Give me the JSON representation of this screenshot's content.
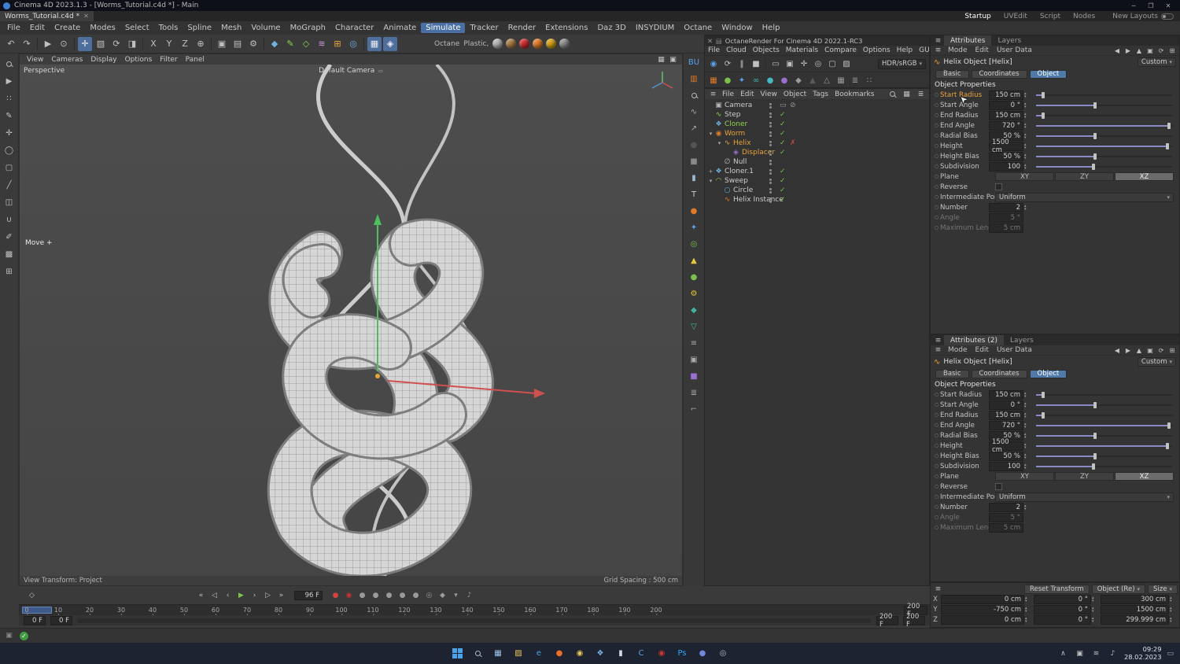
{
  "colors": {
    "accent_blue": "#4e79a8",
    "menu_active_blue": "#4a6fa5",
    "highlight_orange": "#e8a33b",
    "check_green": "#7cc14c",
    "cross_red": "#d04444",
    "slider_fill": "#8a8ac4",
    "taskbar_bg": "#1d2330",
    "viewport_bg": "#484848"
  },
  "titlebar": {
    "title": "Cinema 4D 2023.1.3 - [Worms_Tutorial.c4d *] - Main",
    "controls": [
      {
        "n": "minimize-button",
        "g": "─"
      },
      {
        "n": "maximize-button",
        "g": "❐"
      },
      {
        "n": "close-button",
        "g": "✕"
      }
    ]
  },
  "tabbar": {
    "document_tab": "Worms_Tutorial.c4d *",
    "close_glyph": "✕",
    "layouts": [
      "Startup",
      "UVEdit",
      "Script",
      "Nodes"
    ],
    "active_layout": "Startup",
    "new_layouts_label": "New Layouts"
  },
  "menubar": {
    "items": [
      "File",
      "Edit",
      "Create",
      "Modes",
      "Select",
      "Tools",
      "Spline",
      "Mesh",
      "Volume",
      "MoGraph",
      "Character",
      "Animate",
      "Simulate",
      "Tracker",
      "Render",
      "Extensions",
      "Daz 3D",
      "INSYDIUM",
      "Octane",
      "Window",
      "Help"
    ],
    "active": "Simulate"
  },
  "main_toolbar": {
    "icons": [
      {
        "n": "undo-icon",
        "g": "↶"
      },
      {
        "n": "redo-icon",
        "g": "↷"
      },
      {
        "sep": true
      },
      {
        "n": "selection-tool-icon",
        "g": "▶"
      },
      {
        "n": "live-selection-icon",
        "g": "⊙"
      },
      {
        "sep": true
      },
      {
        "n": "move-tool-icon",
        "g": "✛",
        "hl": true
      },
      {
        "n": "scale-tool-icon",
        "g": "▧"
      },
      {
        "n": "rotate-tool-icon",
        "g": "⟳"
      },
      {
        "n": "last-tool-icon",
        "g": "◨"
      },
      {
        "sep": true
      },
      {
        "n": "x-axis-lock-button",
        "g": "X"
      },
      {
        "n": "y-axis-lock-button",
        "g": "Y"
      },
      {
        "n": "z-axis-lock-button",
        "g": "Z"
      },
      {
        "n": "coordinate-system-button",
        "g": "⊕"
      },
      {
        "sep": true
      },
      {
        "n": "render-view-button",
        "g": "▣"
      },
      {
        "n": "render-picture-viewer-button",
        "g": "▤"
      },
      {
        "n": "render-settings-button",
        "g": "⚙"
      },
      {
        "sep": true
      },
      {
        "n": "primitives-menu-icon",
        "g": "◆",
        "c": "#6fb3e0"
      },
      {
        "n": "spline-pen-menu-icon",
        "g": "✎",
        "c": "#8fd14f"
      },
      {
        "n": "generators-menu-icon",
        "g": "◇",
        "c": "#8fd14f"
      },
      {
        "n": "deformers-menu-icon",
        "g": "≋",
        "c": "#c79bd9"
      },
      {
        "n": "volume-menu-icon",
        "g": "⊞",
        "c": "#e8a33b"
      },
      {
        "n": "fields-menu-icon",
        "g": "◎",
        "c": "#6fb3e0"
      },
      {
        "sep": true
      },
      {
        "n": "workplane-button",
        "g": "▦",
        "hl": true
      },
      {
        "n": "snap-button",
        "g": "◈",
        "hl": true
      }
    ],
    "material_labels": [
      "Octane",
      "Plastic,"
    ],
    "swatches": [
      {
        "n": "material-preview-sphere",
        "c": "#b5b5b5"
      },
      {
        "n": "material-wood-sphere",
        "c": "#a97a45"
      },
      {
        "n": "octane-logo-button",
        "c": "#cc2b2b"
      },
      {
        "n": "octane-render-button",
        "c": "#e07a28"
      },
      {
        "n": "octane-livedb-button",
        "c": "#d4a017"
      },
      {
        "n": "material-sphere-secondary",
        "c": "#8a8a8a"
      }
    ]
  },
  "left_toolbar": {
    "icons": [
      {
        "n": "zoom-tool-icon",
        "mag": true
      },
      {
        "n": "selection-arrow-icon",
        "g": "▶"
      },
      {
        "n": "points-mode-icon",
        "g": "∷"
      },
      {
        "n": "pen-tool-icon",
        "g": "✎"
      },
      {
        "n": "axis-mode-icon",
        "g": "✛"
      },
      {
        "n": "ring-select-icon",
        "g": "◯"
      },
      {
        "n": "plane-tool-icon",
        "g": "▢"
      },
      {
        "n": "knife-tool-icon",
        "g": "╱"
      },
      {
        "n": "mirror-tool-icon",
        "g": "◫"
      },
      {
        "n": "magnet-tool-icon",
        "g": "∪"
      },
      {
        "n": "brush-tool-icon",
        "g": "✐"
      },
      {
        "n": "texture-mode-icon",
        "g": "▩"
      },
      {
        "n": "workplane-mode-icon",
        "g": "⊞"
      }
    ]
  },
  "viewport": {
    "menu": [
      "View",
      "Cameras",
      "Display",
      "Options",
      "Filter",
      "Panel"
    ],
    "view_label": "Perspective",
    "camera_label": "Default Camera",
    "tool_label": "Move",
    "status_left": "View Transform: Project",
    "status_right": "Grid Spacing : 500 cm"
  },
  "right_strip": {
    "icons": [
      {
        "n": "octane-bu-label",
        "g": "BU",
        "c": "#5aa0e8"
      },
      {
        "n": "octane-film-icon",
        "g": "▥",
        "c": "#e07a28"
      },
      {
        "n": "octane-magnifier-icon",
        "mag": true
      },
      {
        "n": "octane-wave-icon",
        "g": "∿",
        "c": "#aaa"
      },
      {
        "n": "octane-chart-icon",
        "g": "↗",
        "c": "#aaa"
      },
      {
        "n": "octane-circle-icon",
        "g": "●",
        "c": "#555"
      },
      {
        "n": "octane-square-icon",
        "g": "■",
        "c": "#888"
      },
      {
        "n": "octane-cylinder-icon",
        "g": "▮",
        "c": "#9ab8d0"
      },
      {
        "n": "octane-text-icon",
        "g": "T",
        "c": "#ccc"
      },
      {
        "n": "octane-sphere-icon",
        "g": "●",
        "c": "#e07a28"
      },
      {
        "n": "octane-character-icon",
        "g": "✦",
        "c": "#5aa0e8"
      },
      {
        "n": "octane-target-icon",
        "g": "◎",
        "c": "#7cc14c"
      },
      {
        "n": "octane-warning-icon",
        "g": "▲",
        "c": "#e8c83b"
      },
      {
        "n": "octane-ball-icon",
        "g": "●",
        "c": "#7cc14c"
      },
      {
        "n": "octane-gear-icon",
        "g": "⚙",
        "c": "#e8c83b"
      },
      {
        "n": "octane-water-icon",
        "g": "◆",
        "c": "#3fb5a0"
      },
      {
        "n": "octane-flask-icon",
        "g": "▽",
        "c": "#3fb5a0"
      },
      {
        "n": "octane-layers-icon",
        "g": "≡",
        "c": "#aaa"
      },
      {
        "n": "octane-camera-icon",
        "g": "▣",
        "c": "#aaa"
      },
      {
        "n": "octane-cube-icon",
        "g": "■",
        "c": "#9b6fd1"
      },
      {
        "n": "octane-sliders-icon",
        "g": "≣",
        "c": "#aaa"
      },
      {
        "n": "octane-clamp-icon",
        "g": "⌐",
        "c": "#aaa"
      }
    ]
  },
  "octane_panel": {
    "title": "OctaneRender For Cinema 4D 2022.1-RC3",
    "close_glyph": "✕",
    "menu": [
      "File",
      "Cloud",
      "Objects",
      "Materials",
      "Compare",
      "Options",
      "Help",
      "GUI"
    ],
    "toolbar1": [
      {
        "n": "octane-power-button",
        "g": "◉",
        "c": "#5aa0e8"
      },
      {
        "n": "octane-restart-button",
        "g": "⟳"
      },
      {
        "n": "octane-pause-button",
        "g": "‖"
      },
      {
        "n": "octane-stop-button",
        "g": "■"
      },
      {
        "sep": true
      },
      {
        "n": "octane-lock-resolution-icon",
        "g": "▭"
      },
      {
        "n": "octane-camera-sync-icon",
        "g": "▣"
      },
      {
        "n": "octane-pick-focus-icon",
        "g": "✛"
      },
      {
        "n": "octane-pick-material-icon",
        "g": "◎"
      },
      {
        "n": "octane-render-region-icon",
        "g": "▢"
      },
      {
        "n": "octane-film-settings-icon",
        "g": "▨"
      }
    ],
    "colorspace": "HDR/sRGB",
    "toolbar2": [
      {
        "n": "octane-target-camera-icon",
        "g": "▦",
        "c": "#e07a28"
      },
      {
        "n": "octane-material-sphere-icon",
        "g": "●",
        "c": "#7cc14c"
      },
      {
        "n": "octane-texture-icon",
        "g": "✦",
        "c": "#5aa0e8"
      },
      {
        "n": "octane-mix-material-icon",
        "g": "∞",
        "c": "#3fb5a0"
      },
      {
        "n": "octane-glossy-icon",
        "g": "●",
        "c": "#49b6c4"
      },
      {
        "n": "octane-specular-icon",
        "g": "●",
        "c": "#9b6fd1"
      },
      {
        "n": "octane-diamond-icon",
        "g": "◆",
        "c": "#9a9a9a"
      },
      {
        "n": "octane-mesh-dark-icon",
        "g": "▲",
        "c": "#5a5a5a"
      },
      {
        "n": "octane-mesh-icon",
        "g": "△",
        "c": "#9a9a9a"
      },
      {
        "n": "octane-grid-icon",
        "g": "▦",
        "c": "#9a9a9a"
      },
      {
        "n": "octane-list-icon",
        "g": "≣",
        "c": "#9a9a9a"
      },
      {
        "n": "octane-dots-icon",
        "g": "∷",
        "c": "#9a9a9a"
      }
    ]
  },
  "object_manager": {
    "menu": [
      "File",
      "Edit",
      "View",
      "Object",
      "Tags",
      "Bookmarks"
    ],
    "items": [
      {
        "name": "Camera",
        "depth": 0,
        "glyph": "▣",
        "icon": "camera-object-icon",
        "icon_color": "#b5b5b5",
        "marks": [
          "tag",
          "slash"
        ]
      },
      {
        "name": "Step",
        "depth": 0,
        "glyph": "∿",
        "icon": "step-effector-icon",
        "icon_color": "#8fd14f",
        "marks": [
          "check"
        ]
      },
      {
        "name": "Cloner",
        "depth": 0,
        "glyph": "❖",
        "icon": "cloner-object-icon",
        "icon_color": "#6fb3e0",
        "text_color": "#8fd14f",
        "marks": [
          "check"
        ]
      },
      {
        "name": "Worm",
        "depth": 0,
        "exp": "▾",
        "glyph": "◉",
        "icon": "worm-object-icon",
        "icon_color": "#e07a28",
        "text_color": "#e8a33b",
        "marks": [
          "check"
        ]
      },
      {
        "name": "Helix",
        "depth": 1,
        "exp": "▾",
        "glyph": "∿",
        "icon": "helix-spline-icon",
        "icon_color": "#e8a33b",
        "text_color": "#e8a33b",
        "marks": [
          "check",
          "cross"
        ]
      },
      {
        "name": "Displacer",
        "depth": 2,
        "glyph": "◈",
        "icon": "displacer-icon",
        "icon_color": "#9b6fd1",
        "text_color": "#e8a33b",
        "marks": [
          "check"
        ]
      },
      {
        "name": "Null",
        "depth": 1,
        "glyph": "∅",
        "icon": "null-object-icon",
        "icon_color": "#b5b5b5",
        "marks": []
      },
      {
        "name": "Cloner.1",
        "depth": 0,
        "exp": "+",
        "glyph": "❖",
        "icon": "cloner-object-icon",
        "icon_color": "#6fb3e0",
        "marks": [
          "check"
        ]
      },
      {
        "name": "Sweep",
        "depth": 0,
        "exp": "▾",
        "glyph": "◠",
        "icon": "sweep-object-icon",
        "icon_color": "#8fd14f",
        "marks": [
          "check"
        ]
      },
      {
        "name": "Circle",
        "depth": 1,
        "glyph": "○",
        "icon": "circle-spline-icon",
        "icon_color": "#6fb3e0",
        "marks": [
          "check"
        ]
      },
      {
        "name": "Helix Instance",
        "depth": 1,
        "glyph": "∿",
        "icon": "instance-object-icon",
        "icon_color": "#e07a28",
        "marks": [
          "check"
        ]
      }
    ]
  },
  "attributes": {
    "tab_active": "Attributes",
    "tab_layers": "Layers",
    "panel2_tab": "Attributes (2)",
    "mode_menu": [
      "Mode",
      "Edit",
      "User Data"
    ],
    "header_icons": [
      {
        "g": "◀"
      },
      {
        "g": "▶"
      },
      {
        "g": "▲"
      },
      {
        "g": "▣"
      },
      {
        "g": "⟳"
      },
      {
        "g": "⊞"
      }
    ],
    "object_title": "Helix Object [Helix]",
    "preset_label": "Custom",
    "tabs": [
      "Basic",
      "Coordinates",
      "Object"
    ],
    "active_tab": "Object",
    "section_title": "Object Properties",
    "rows": [
      {
        "label": "Start Radius",
        "value": "150 cm",
        "slider": 0.05
      },
      {
        "label": "Start Angle",
        "value": "0 °",
        "slider": 0.43
      },
      {
        "label": "End Radius",
        "value": "150 cm",
        "slider": 0.05
      },
      {
        "label": "End Angle",
        "value": "720 °",
        "slider": 0.97
      },
      {
        "label": "Radial Bias",
        "value": "50 %",
        "slider": 0.43
      },
      {
        "label": "Height",
        "value": "1500 cm",
        "slider": 0.96
      },
      {
        "label": "Height Bias",
        "value": "50 %",
        "slider": 0.43
      },
      {
        "label": "Subdivision",
        "value": "100",
        "slider": 0.42
      }
    ],
    "plane": {
      "label": "Plane",
      "options": [
        "XY",
        "ZY",
        "XZ"
      ],
      "active": "XZ"
    },
    "reverse_label": "Reverse",
    "intermediate": {
      "label": "Intermediate Points",
      "value": "Uniform"
    },
    "number": {
      "label": "Number",
      "value": "2"
    },
    "disabled_rows": [
      {
        "label": "Angle",
        "value": "5 °"
      },
      {
        "label": "Maximum Length",
        "value": "5 cm"
      }
    ]
  },
  "coordinates": {
    "buttons": [
      {
        "n": "reset-transform-button",
        "label": "Reset Transform"
      },
      {
        "n": "object-mode-select",
        "label": "Object (Re)",
        "dd": true
      },
      {
        "n": "size-mode-select",
        "label": "Size",
        "dd": true
      }
    ],
    "rows": [
      {
        "axis": "X",
        "pos": "0 cm",
        "rot": "0 °",
        "size": "300 cm"
      },
      {
        "axis": "Y",
        "pos": "-750 cm",
        "rot": "0 °",
        "size": "1500 cm"
      },
      {
        "axis": "Z",
        "pos": "0 cm",
        "rot": "0 °",
        "size": "299.999 cm"
      }
    ]
  },
  "timeline": {
    "frame_value": "96 F",
    "left_icon": "◇",
    "transport": [
      {
        "n": "goto-start-button",
        "g": "«"
      },
      {
        "n": "prev-key-button",
        "g": "◁"
      },
      {
        "n": "prev-frame-button",
        "g": "‹"
      },
      {
        "n": "play-button",
        "g": "▶",
        "c": "#7cc14c"
      },
      {
        "n": "next-frame-button",
        "g": "›"
      },
      {
        "n": "next-key-button",
        "g": "▷"
      },
      {
        "n": "goto-end-button",
        "g": "»"
      }
    ],
    "record": [
      {
        "n": "record-button",
        "g": "●",
        "c": "#d04444"
      },
      {
        "n": "octane-record-icon",
        "g": "◉",
        "c": "#cc3333"
      },
      {
        "n": "record-position-button",
        "g": "●",
        "c": "#9a9a9a"
      },
      {
        "n": "record-scale-button",
        "g": "●",
        "c": "#9a9a9a"
      },
      {
        "n": "record-rotation-button",
        "g": "●",
        "c": "#9a9a9a"
      },
      {
        "n": "record-parameter-button",
        "g": "●",
        "c": "#9a9a9a"
      },
      {
        "n": "record-pla-button",
        "g": "●",
        "c": "#9a9a9a"
      },
      {
        "n": "autokey-button",
        "g": "◎",
        "c": "#9a9a9a"
      },
      {
        "n": "keyframe-selection-button",
        "g": "◆",
        "c": "#9a9a9a"
      },
      {
        "n": "playback-options-button",
        "g": "▾",
        "c": "#9a9a9a"
      },
      {
        "n": "sound-button",
        "g": "♪",
        "c": "#9a9a9a"
      }
    ],
    "ticks": [
      "0",
      "10",
      "20",
      "30",
      "40",
      "50",
      "60",
      "70",
      "80",
      "90",
      "100",
      "110",
      "120",
      "130",
      "140",
      "150",
      "160",
      "170",
      "180",
      "190",
      "200"
    ],
    "end_frame_box": "200 F",
    "range_fields": [
      "0 F",
      "0 F",
      "200 F",
      "200 F"
    ]
  },
  "status": {
    "check_glyph": "✓"
  },
  "taskbar": {
    "time": "09:29",
    "date": "28.02.2023",
    "center_icons": [
      {
        "n": "start-button",
        "win": true
      },
      {
        "n": "taskbar-search-icon",
        "mag": true
      },
      {
        "n": "taskbar-taskview-icon",
        "g": "▦",
        "c": "#9fc4e8"
      },
      {
        "n": "taskbar-explorer-icon",
        "g": "▨",
        "c": "#e8c35a"
      },
      {
        "n": "taskbar-edge-icon",
        "g": "e",
        "c": "#4aa3e8"
      },
      {
        "n": "taskbar-firefox-icon",
        "g": "●",
        "c": "#e8702a"
      },
      {
        "n": "taskbar-chrome-icon",
        "g": "◉",
        "c": "#e8c35a"
      },
      {
        "n": "taskbar-photos-icon",
        "g": "❖",
        "c": "#7ab8e8"
      },
      {
        "n": "taskbar-terminal-icon",
        "g": "▮",
        "c": "#cfd8e3"
      },
      {
        "n": "taskbar-c4d-icon",
        "g": "C",
        "c": "#5aa0e8"
      },
      {
        "n": "taskbar-octane-icon",
        "g": "◉",
        "c": "#cc3333"
      },
      {
        "n": "taskbar-photoshop-icon",
        "g": "Ps",
        "c": "#31a8ff"
      },
      {
        "n": "taskbar-discord-icon",
        "g": "●",
        "c": "#7289da"
      },
      {
        "n": "taskbar-obs-icon",
        "g": "◎",
        "c": "#b5bdc9"
      }
    ],
    "tray_icons": [
      {
        "n": "tray-chevron-icon",
        "g": "∧"
      },
      {
        "n": "tray-app-icon",
        "g": "▣"
      },
      {
        "n": "tray-network-icon",
        "g": "≋"
      },
      {
        "n": "tray-volume-icon",
        "g": "♪"
      }
    ],
    "notification_icon": "▭"
  }
}
